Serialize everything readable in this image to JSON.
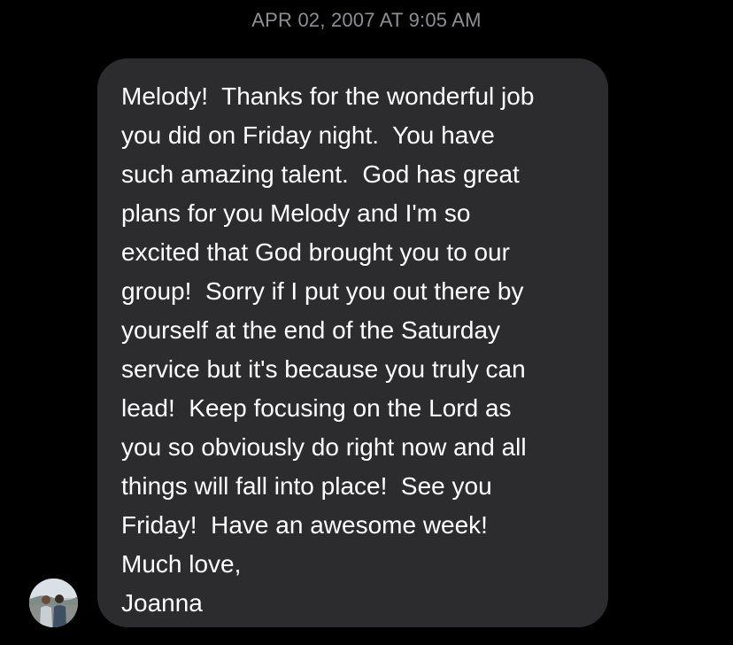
{
  "timestamp": "APR 02, 2007 AT 9:05 AM",
  "sender": {
    "avatar_icon": "person-photo-avatar"
  },
  "message": {
    "lines": [
      "Melody!  Thanks for the wonderful job",
      "you did on Friday night.  You have",
      "such amazing talent.  God has great",
      "plans for you Melody and I'm so",
      "excited that God brought you to our",
      "group!  Sorry if I put you out there by",
      "yourself at the end of the Saturday",
      "service but it's because you truly can",
      "lead!  Keep focusing on the Lord as",
      "you so obviously do right now and all",
      "things will fall into place!  See you",
      "Friday!  Have an awesome week!",
      "Much love,",
      "Joanna"
    ]
  },
  "colors": {
    "background": "#000000",
    "bubble": "#2c2c2e",
    "timestamp_text": "#8e8e93",
    "message_text": "#ffffff"
  }
}
